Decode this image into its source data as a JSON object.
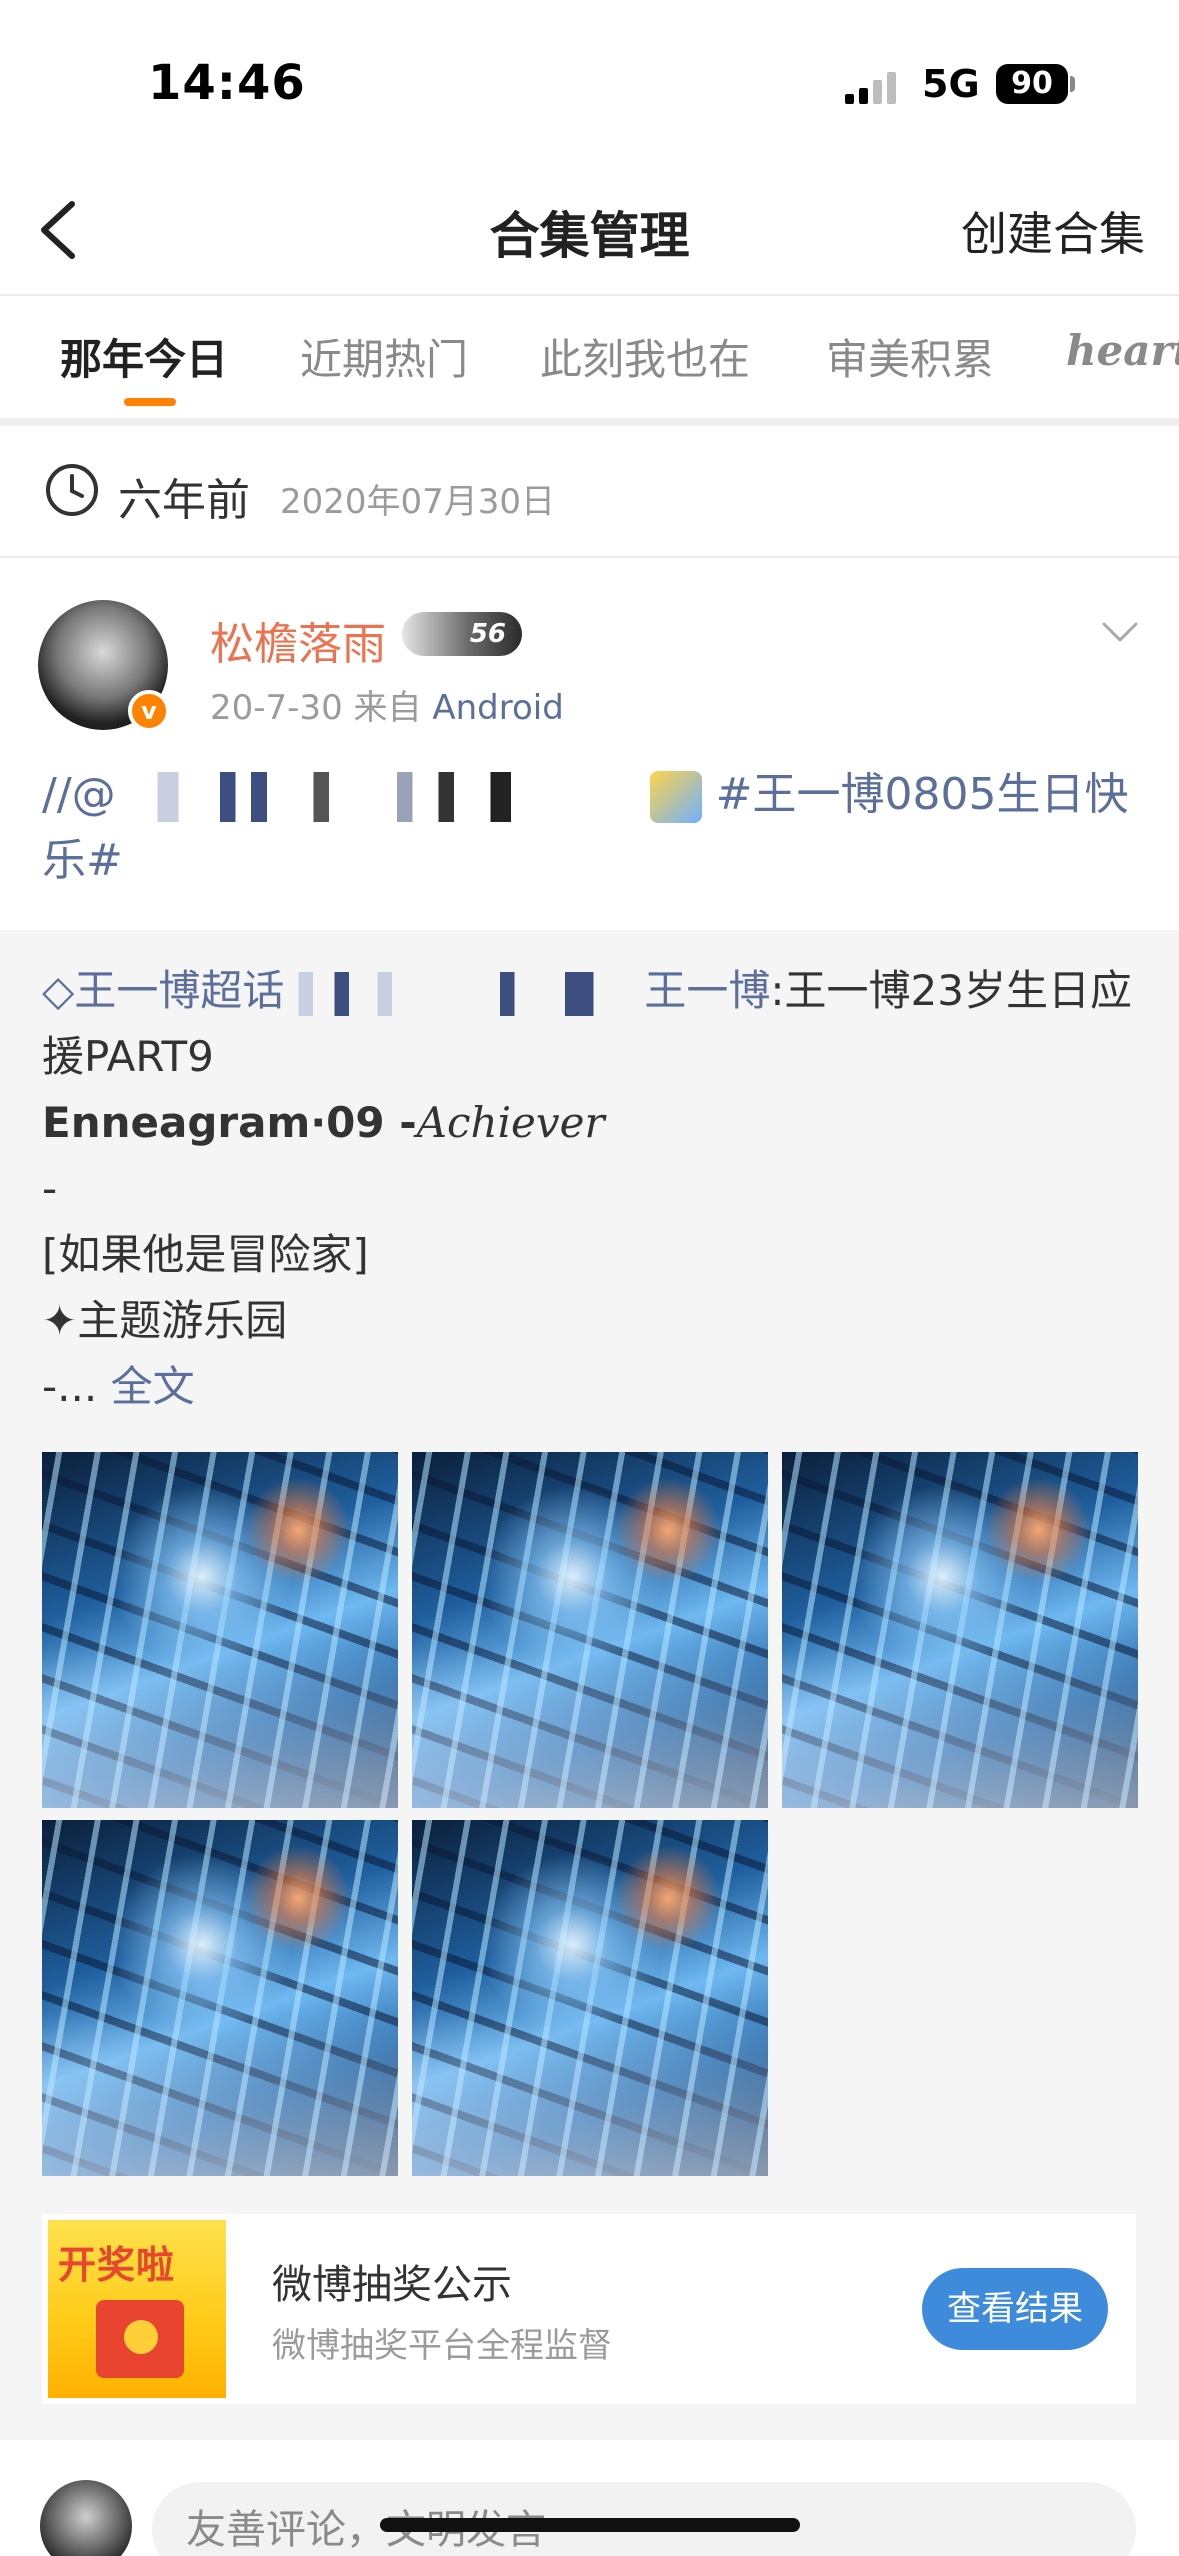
{
  "status": {
    "time": "14:46",
    "network": "5G",
    "battery": "90"
  },
  "nav": {
    "title": "合集管理",
    "action": "创建合集"
  },
  "tabs": [
    "那年今日",
    "近期热门",
    "此刻我也在",
    "审美积累",
    "heart"
  ],
  "date": {
    "relative": "六年前",
    "absolute": "2020年07月30日"
  },
  "post": {
    "username": "松檐落雨",
    "badge": "56",
    "verified_mark": "v",
    "meta_date": "20-7-30",
    "meta_from": "来自",
    "meta_source": "Android",
    "text_prefix": "//@",
    "hashtag": "#王一博0805生日快乐#"
  },
  "retweet": {
    "super_topic": "王一博超话",
    "author_tail": "王一博",
    "title_tail": ":王一博23岁生日应援PART9",
    "ennea_bold": "Enneagram·09 -",
    "ennea_italic": "Achiever",
    "line_dash": "-",
    "line_bracket": "[如果他是冒险家]",
    "line_theme": "✦主题游乐园",
    "ellipsis": "-...",
    "full_text": "全文"
  },
  "lottery": {
    "image_text": "开奖啦",
    "title": "微博抽奖公示",
    "subtitle": "微博抽奖平台全程监督",
    "button": "查看结果"
  },
  "comment": {
    "placeholder": "友善评论，文明发言"
  },
  "colors": {
    "accent": "#ff8200",
    "link": "#5b6f9a",
    "username": "#eb7350",
    "button": "#3e8bdb"
  }
}
